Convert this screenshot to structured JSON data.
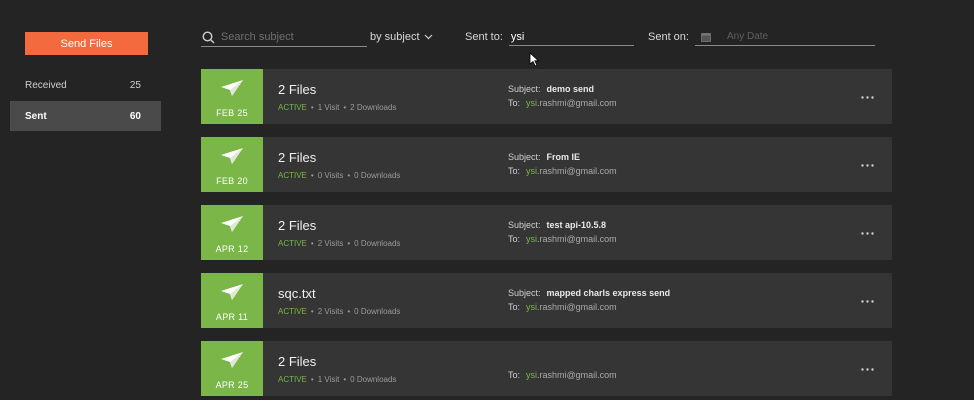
{
  "sidebar": {
    "send_button": "Send Files",
    "items": [
      {
        "label": "Received",
        "count": "25"
      },
      {
        "label": "Sent",
        "count": "60"
      }
    ]
  },
  "filters": {
    "search_placeholder": "Search subject",
    "sort_label": "by subject",
    "sent_to_label": "Sent to:",
    "sent_to_value": "ysi",
    "sent_on_label": "Sent on:",
    "sent_on_placeholder": "Any Date"
  },
  "icons": {
    "search": "search-icon",
    "chevron": "chevron-down-icon",
    "calendar": "calendar-icon",
    "plane": "paper-plane-icon",
    "more": "more-dots-icon"
  },
  "colors": {
    "accent_orange": "#f26a3d",
    "accent_green": "#7ab648",
    "background": "#242424",
    "row_bg": "#353535"
  },
  "labels": {
    "subject": "Subject:",
    "to": "To:",
    "separator": "•"
  },
  "transfers": [
    {
      "date": "FEB 25",
      "title": "2 Files",
      "status": "ACTIVE",
      "visits": "1 Visit",
      "downloads": "2 Downloads",
      "subject": "demo send",
      "to_highlight": "ysi",
      "to_rest": ".rashmi@gmail.com"
    },
    {
      "date": "FEB 20",
      "title": "2 Files",
      "status": "ACTIVE",
      "visits": "0 Visits",
      "downloads": "0 Downloads",
      "subject": "From IE",
      "to_highlight": "ysi",
      "to_rest": ".rashmi@gmail.com"
    },
    {
      "date": "APR 12",
      "title": "2 Files",
      "status": "ACTIVE",
      "visits": "2 Visits",
      "downloads": "0 Downloads",
      "subject": "test api-10.5.8",
      "to_highlight": "ysi",
      "to_rest": ".rashmi@gmail.com"
    },
    {
      "date": "APR 11",
      "title": "sqc.txt",
      "status": "ACTIVE",
      "visits": "2 Visits",
      "downloads": "0 Downloads",
      "subject": "mapped charls express send",
      "to_highlight": "ysi",
      "to_rest": ".rashmi@gmail.com"
    },
    {
      "date": "APR 25",
      "title": "2 Files",
      "status": "ACTIVE",
      "visits": "1 Visit",
      "downloads": "0 Downloads",
      "subject": "",
      "to_highlight": "ysi",
      "to_rest": ".rashmi@gmail.com"
    }
  ]
}
